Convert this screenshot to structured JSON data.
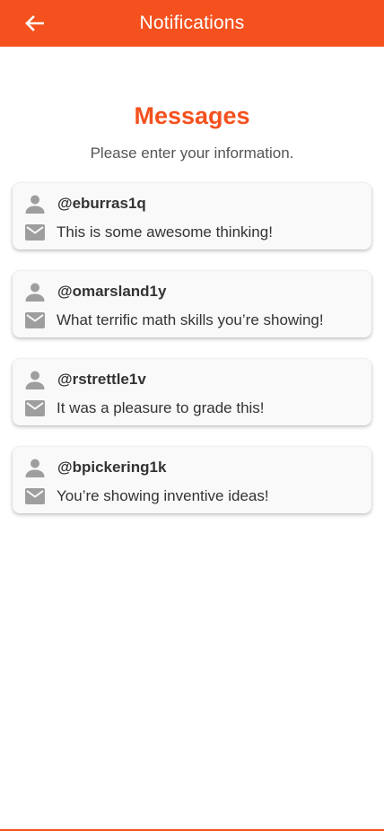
{
  "header": {
    "title": "Notifications",
    "back_icon": "arrow-left-icon"
  },
  "page": {
    "title": "Messages",
    "subtitle": "Please enter your information."
  },
  "messages": [
    {
      "username": "@eburras1q",
      "text": "This is some awesome thinking!"
    },
    {
      "username": "@omarsland1y",
      "text": "What terrific math skills you’re showing!"
    },
    {
      "username": "@rstrettle1v",
      "text": "It was a pleasure to grade this!"
    },
    {
      "username": "@bpickering1k",
      "text": "You’re showing inventive ideas!"
    }
  ],
  "colors": {
    "accent": "#f4511e",
    "icon": "#9e9e9e",
    "text": "#333333",
    "card": "#f9f9f9"
  }
}
